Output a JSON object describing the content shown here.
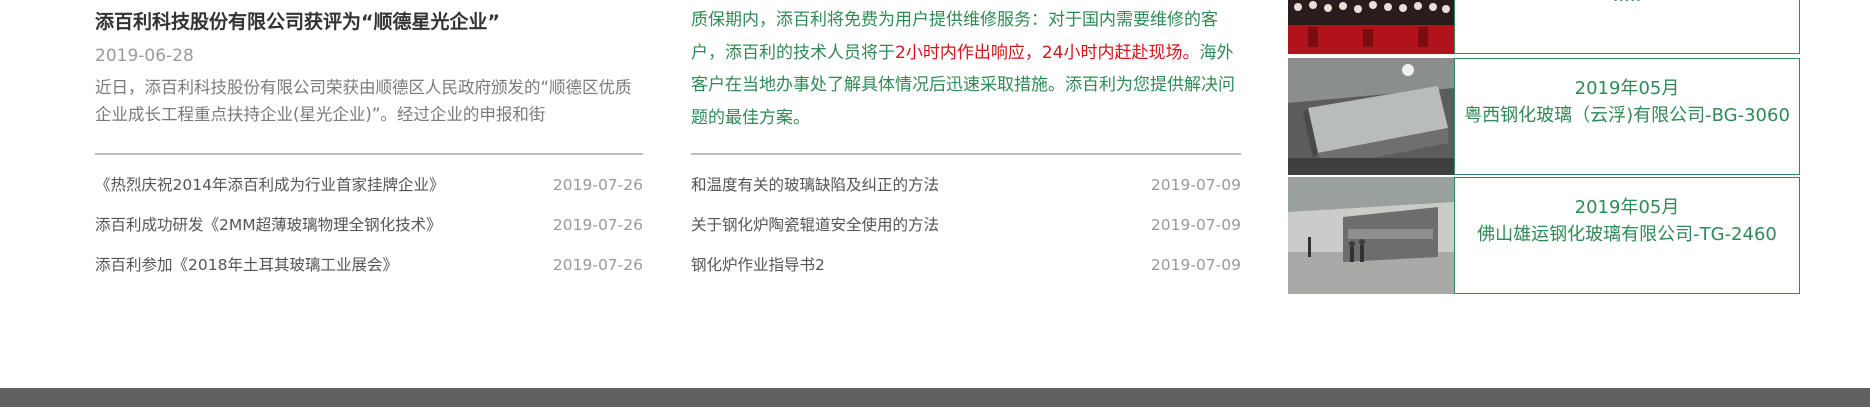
{
  "news": {
    "featured": {
      "title": "添百利科技股份有限公司获评为“顺德星光企业”",
      "date": "2019-06-28",
      "summary": "近日，添百利科技股份有限公司荣获由顺德区人民政府颁发的“顺德区优质企业成长工程重点扶持企业(星光企业)”。经过企业的申报和街"
    },
    "items": [
      {
        "title": "《热烈庆祝2014年添百利成为行业首家挂牌企业》",
        "date": "2019-07-26"
      },
      {
        "title": "添百利成功研发《2MM超薄玻璃物理全钢化技术》",
        "date": "2019-07-26"
      },
      {
        "title": "添百利参加《2018年土耳其玻璃工业展会》",
        "date": "2019-07-26"
      }
    ]
  },
  "service": {
    "text_before": "质保期内，添百利将免费为用户提供维修服务：对于国内需要维修的客户，添百利的技术人员将于",
    "text_highlight": "2小时内作出响应，24小时内赶赴现场。",
    "text_after": "海外客户在当地办事处了解具体情况后迅速采取措施。添百利为您提供解决问题的最佳方案。",
    "items": [
      {
        "title": "和温度有关的玻璃缺陷及纠正的方法",
        "date": "2019-07-09"
      },
      {
        "title": "关于钢化炉陶瓷辊道安全使用的方法",
        "date": "2019-07-09"
      },
      {
        "title": "钢化炉作业指导书2",
        "date": "2019-07-09"
      }
    ]
  },
  "cases": {
    "top_partial_label": "·····",
    "items": [
      {
        "date": "2019年05月",
        "name": "粤西钢化玻璃（云浮)有限公司-BG-3060",
        "image": "factory-furnace-photo"
      },
      {
        "date": "2019年05月",
        "name": "佛山雄运钢化玻璃有限公司-TG-2460",
        "image": "factory-workshop-photo"
      }
    ],
    "top_image": "event-stage-photo"
  },
  "colors": {
    "accent_green": "#2f8a57",
    "highlight_red": "#d7141a",
    "footer": "#616161"
  }
}
